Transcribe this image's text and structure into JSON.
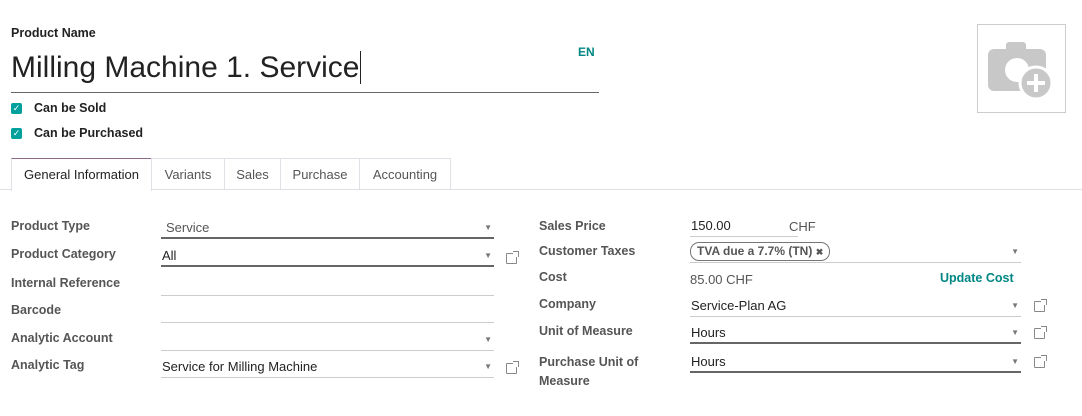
{
  "header": {
    "product_name_label": "Product Name",
    "product_name": "Milling Machine 1. Service",
    "language": "EN",
    "image_icon": "camera-plus-icon"
  },
  "checkboxes": [
    {
      "label": "Can be Sold",
      "checked": true
    },
    {
      "label": "Can be Purchased",
      "checked": true
    }
  ],
  "tabs": [
    {
      "label": "General Information",
      "active": true
    },
    {
      "label": "Variants"
    },
    {
      "label": "Sales"
    },
    {
      "label": "Purchase"
    },
    {
      "label": "Accounting"
    }
  ],
  "left": {
    "product_type": {
      "label": "Product Type",
      "value": "Service"
    },
    "product_category": {
      "label": "Product Category",
      "value": "All"
    },
    "internal_reference": {
      "label": "Internal Reference",
      "value": ""
    },
    "barcode": {
      "label": "Barcode",
      "value": ""
    },
    "analytic_account": {
      "label": "Analytic Account",
      "value": ""
    },
    "analytic_tag": {
      "label": "Analytic Tag",
      "value": "Service for Milling Machine"
    }
  },
  "right": {
    "sales_price": {
      "label": "Sales Price",
      "value": "150.00",
      "currency": "CHF"
    },
    "customer_taxes": {
      "label": "Customer Taxes",
      "tag": "TVA due a 7.7% (TN)",
      "remove": "✖"
    },
    "cost": {
      "label": "Cost",
      "value": "85.00 CHF",
      "action": "Update Cost"
    },
    "company": {
      "label": "Company",
      "value": "Service-Plan AG"
    },
    "uom": {
      "label": "Unit of Measure",
      "value": "Hours"
    },
    "purchase_uom": {
      "label": "Purchase Unit of Measure",
      "value": "Hours"
    }
  },
  "colors": {
    "accent": "#00a09d",
    "link": "#008784",
    "tab_active": "#8f6a8f"
  }
}
